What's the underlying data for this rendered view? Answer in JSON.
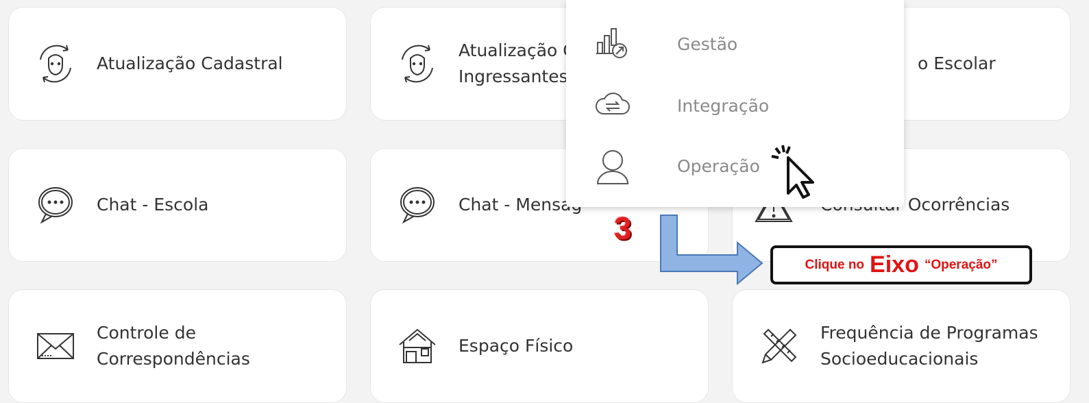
{
  "cards": [
    {
      "id": "atualizacao-cadastral",
      "label": "Atualização Cadastral",
      "icon": "face-refresh-icon"
    },
    {
      "id": "atualizacao-ingressantes",
      "label": "Atualização C\nIngressantes",
      "icon": "face-refresh-icon"
    },
    {
      "id": "escolar",
      "label": "o Escolar",
      "icon": ""
    },
    {
      "id": "chat-escola",
      "label": "Chat - Escola",
      "icon": "chat-bubble-icon"
    },
    {
      "id": "chat-mensagens",
      "label": "Chat - Mensag",
      "icon": "chat-bubble-icon"
    },
    {
      "id": "consultar-ocorrencias",
      "label": "Consultar Ocorrências",
      "icon": "warning-sign-icon"
    },
    {
      "id": "controle-correspondencias",
      "label": "Controle de\nCorrespondências",
      "icon": "envelope-icon"
    },
    {
      "id": "espaco-fisico",
      "label": "Espaço Físico",
      "icon": "building-icon"
    },
    {
      "id": "frequencia-programas",
      "label": "Frequência de Programas\nSocioeducacionais",
      "icon": "pencil-ruler-icon"
    }
  ],
  "dropdown": {
    "items": [
      {
        "label": "Gestão",
        "icon": "chart-growth-icon"
      },
      {
        "label": "Integração",
        "icon": "cloud-sync-icon"
      },
      {
        "label": "Operação",
        "icon": "user-outline-icon"
      }
    ]
  },
  "annotation": {
    "step_number": "3",
    "callout_prefix": "Clique no",
    "callout_emphasis": "Eixo",
    "callout_suffix": "“Operação”",
    "accent_color": "#e01414",
    "arrow_color": "#8fb4e3"
  }
}
